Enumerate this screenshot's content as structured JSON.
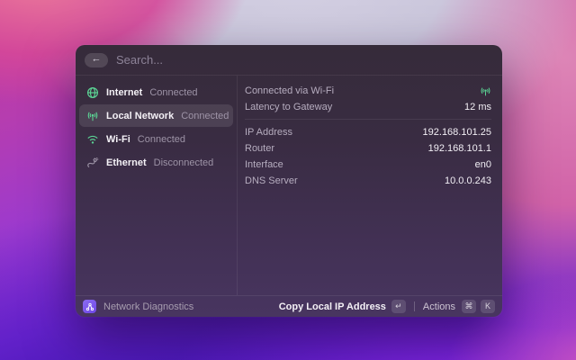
{
  "search": {
    "placeholder": "Search...",
    "back_icon": "←"
  },
  "sidebar": {
    "items": [
      {
        "label": "Internet",
        "status": "Connected",
        "icon": "globe-icon",
        "selected": false
      },
      {
        "label": "Local Network",
        "status": "Connected",
        "icon": "antenna-icon",
        "selected": true
      },
      {
        "label": "Wi-Fi",
        "status": "Connected",
        "icon": "wifi-icon",
        "selected": false
      },
      {
        "label": "Ethernet",
        "status": "Disconnected",
        "icon": "cable-icon",
        "selected": false
      }
    ]
  },
  "details": {
    "rows": [
      {
        "label": "Connected via Wi-Fi",
        "value": "",
        "value_icon": "antenna-icon"
      },
      {
        "label": "Latency to Gateway",
        "value": "12 ms"
      },
      {
        "label": "IP Address",
        "value": "192.168.101.25"
      },
      {
        "label": "Router",
        "value": "192.168.101.1"
      },
      {
        "label": "Interface",
        "value": "en0"
      },
      {
        "label": "DNS Server",
        "value": "10.0.0.243"
      }
    ]
  },
  "footer": {
    "app_name": "Network Diagnostics",
    "primary_action_label": "Copy Local IP Address",
    "primary_action_key": "↵",
    "actions_label": "Actions",
    "actions_keys": [
      "⌘",
      "K"
    ]
  },
  "colors": {
    "accent_green": "#5bd394",
    "disconnected_gray": "#9d93a6",
    "app_icon_purple": "#7a55ec"
  }
}
